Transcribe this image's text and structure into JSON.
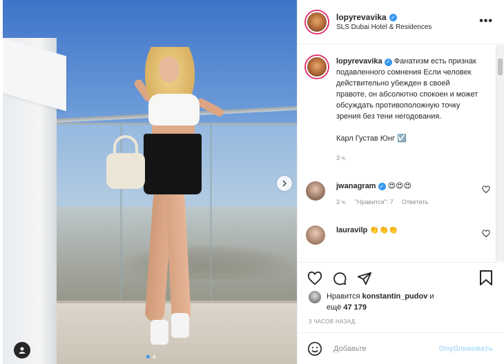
{
  "post": {
    "username": "lopyrevavika",
    "location": "SLS Dubai Hotel & Residences",
    "more_label": "•••"
  },
  "caption": {
    "username": "lopyrevavika",
    "text": "Фанатизм есть признак подавленного сомнения Если человек действительно убежден в своей правоте, он абсолютно спокоен и может обсуждать противоположную точку зрения без тени негодования.",
    "signature": "Карл Густав Юнг ☑️",
    "time": "3 ч."
  },
  "comments": [
    {
      "username": "jwanagram",
      "text": "😍😍😍",
      "time": "3 ч.",
      "likes": "\"Нравится\": 7",
      "reply": "Ответить"
    },
    {
      "username": "lauravilp",
      "text": "👏👏👏"
    }
  ],
  "likes": {
    "prefix": "Нравится",
    "user": "konstantin_pudov",
    "suffix_and": "и",
    "more_prefix": "ещё",
    "count": "47 179"
  },
  "posted_time": "3 ЧАСОВ НАЗАД",
  "comment_box": {
    "placeholder": "Добавьте",
    "publish": "Опубликовать"
  },
  "icons": {
    "next": "chevron-right-icon",
    "tag": "person-tag-icon",
    "like": "heart-icon",
    "comment": "comment-bubble-icon",
    "share": "paper-plane-icon",
    "save": "bookmark-icon",
    "emoji": "smiley-icon",
    "verified": "verified-badge-icon"
  },
  "colors": {
    "verified": "#3897f0",
    "publish_disabled": "#b2dffc",
    "story_ring": "#e1306c"
  },
  "carousel": {
    "slides": 2,
    "active": 1
  }
}
